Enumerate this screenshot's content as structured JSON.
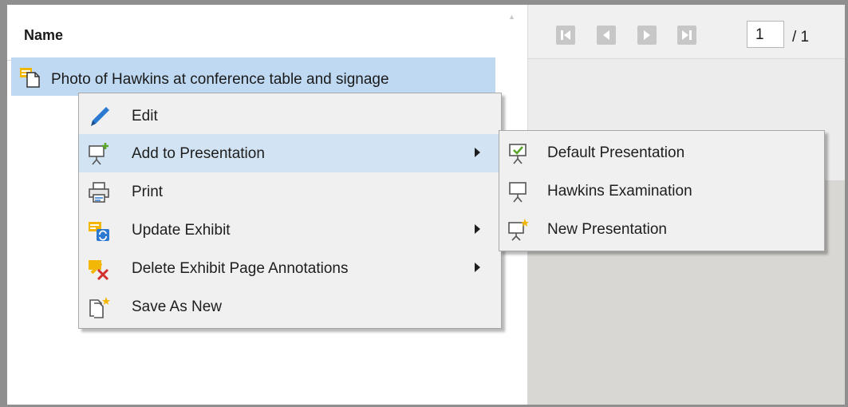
{
  "list": {
    "header": "Name",
    "row_label": "Photo of Hawkins at conference table and signage"
  },
  "viewer": {
    "page_value": "1",
    "page_total": "/ 1",
    "nav_icons": [
      "first-page-icon",
      "previous-page-icon",
      "next-page-icon",
      "last-page-icon"
    ]
  },
  "context_menu": {
    "items": [
      {
        "label": "Edit",
        "icon": "pencil-icon"
      },
      {
        "label": "Add to Presentation",
        "icon": "presentation-add-icon",
        "submenu": true,
        "highlighted": true
      },
      {
        "label": "Print",
        "icon": "printer-icon"
      },
      {
        "label": "Update Exhibit",
        "icon": "update-exhibit-icon",
        "submenu": true
      },
      {
        "label": "Delete Exhibit Page Annotations",
        "icon": "delete-annotations-icon",
        "submenu": true
      },
      {
        "label": "Save As New",
        "icon": "save-as-new-icon"
      }
    ]
  },
  "submenu": {
    "items": [
      {
        "label": "Default Presentation",
        "icon": "presentation-default-icon"
      },
      {
        "label": "Hawkins Examination",
        "icon": "presentation-icon"
      },
      {
        "label": "New Presentation",
        "icon": "presentation-new-icon"
      }
    ]
  },
  "colors": {
    "selection": "#bfd9f2",
    "menu_highlight": "#d2e4f3",
    "menu_background": "#f0f0f0",
    "accent_blue": "#2b79d1",
    "accent_yellow": "#f2b705",
    "accent_green": "#5aa52a",
    "accent_red": "#d32f2f"
  }
}
